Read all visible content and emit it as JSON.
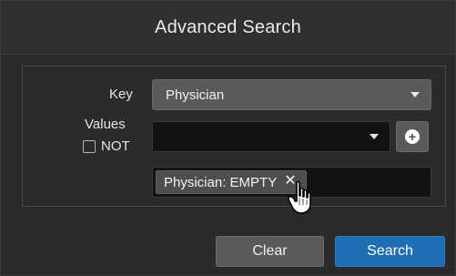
{
  "dialog": {
    "title": "Advanced Search"
  },
  "form": {
    "key_label": "Key",
    "values_label": "Values",
    "not_label": "NOT",
    "key_dropdown_value": "Physician",
    "values_dropdown_value": "",
    "selected_chips": [
      {
        "label": "Physician: EMPTY"
      }
    ]
  },
  "buttons": {
    "clear": "Clear",
    "search": "Search"
  },
  "icons": {
    "add": "plus-circle-icon",
    "remove": "close-icon",
    "dropdown": "chevron-down-icon",
    "cursor": "hand-pointer-icon"
  },
  "colors": {
    "primary": "#1f6db3",
    "secondary": "#5a5a5a",
    "background": "#2a2a2a",
    "field_dark": "#121212"
  }
}
